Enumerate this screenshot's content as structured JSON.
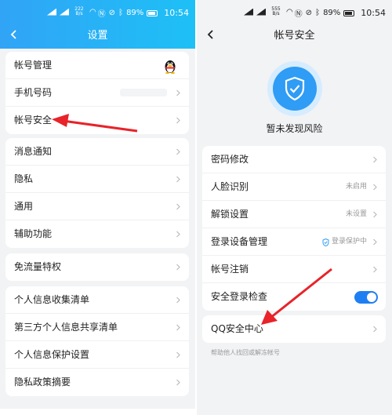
{
  "left": {
    "status": {
      "net": "222 B/s",
      "battery": "89%",
      "time": "10:54"
    },
    "title": "设置",
    "groups": [
      [
        {
          "label": "帐号管理"
        },
        {
          "label": "手机号码"
        },
        {
          "label": "帐号安全"
        }
      ],
      [
        {
          "label": "消息通知"
        },
        {
          "label": "隐私"
        },
        {
          "label": "通用"
        },
        {
          "label": "辅助功能"
        }
      ],
      [
        {
          "label": "免流量特权"
        }
      ],
      [
        {
          "label": "个人信息收集清单"
        },
        {
          "label": "第三方个人信息共享清单"
        },
        {
          "label": "个人信息保护设置"
        },
        {
          "label": "隐私政策摘要"
        }
      ]
    ]
  },
  "right": {
    "status": {
      "net": "555 B/s",
      "battery": "89%",
      "time": "10:54"
    },
    "title": "帐号安全",
    "hero_text": "暂未发现风险",
    "rows": [
      {
        "label": "密码修改"
      },
      {
        "label": "人脸识别",
        "value": "未启用"
      },
      {
        "label": "解锁设置",
        "value": "未设置"
      },
      {
        "label": "登录设备管理",
        "badge": "登录保护中"
      },
      {
        "label": "帐号注销"
      },
      {
        "label": "安全登录检查",
        "toggle": true
      }
    ],
    "qq_center": {
      "label": "QQ安全中心"
    },
    "hint": "帮助他人找回或解冻帐号"
  },
  "colors": {
    "header_start": "#31a4f6",
    "header_end": "#1ec0f6",
    "accent": "#1e7ff2",
    "arrow": "#e8232a"
  }
}
